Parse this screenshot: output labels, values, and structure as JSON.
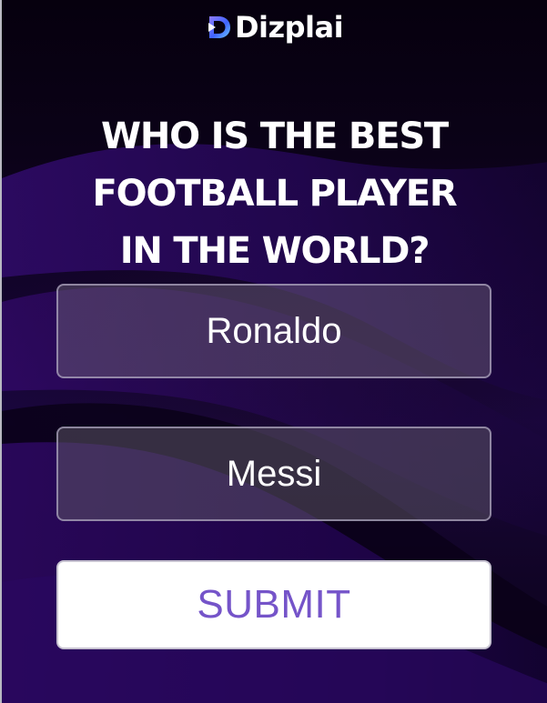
{
  "brand": {
    "name": "Dizplai",
    "primary_color": "#7554c9",
    "mark_colors": [
      "#3f63ff",
      "#8f7cff",
      "#6dc9ff"
    ]
  },
  "question": {
    "line1": "WHO IS THE BEST",
    "line2": "FOOTBALL PLAYER",
    "line3": "IN THE WORLD?"
  },
  "options": [
    {
      "label": "Ronaldo"
    },
    {
      "label": "Messi"
    }
  ],
  "submit": {
    "label": "SUBMIT"
  },
  "theme": {
    "background": "#12052a",
    "button_text": "#7554c9"
  }
}
